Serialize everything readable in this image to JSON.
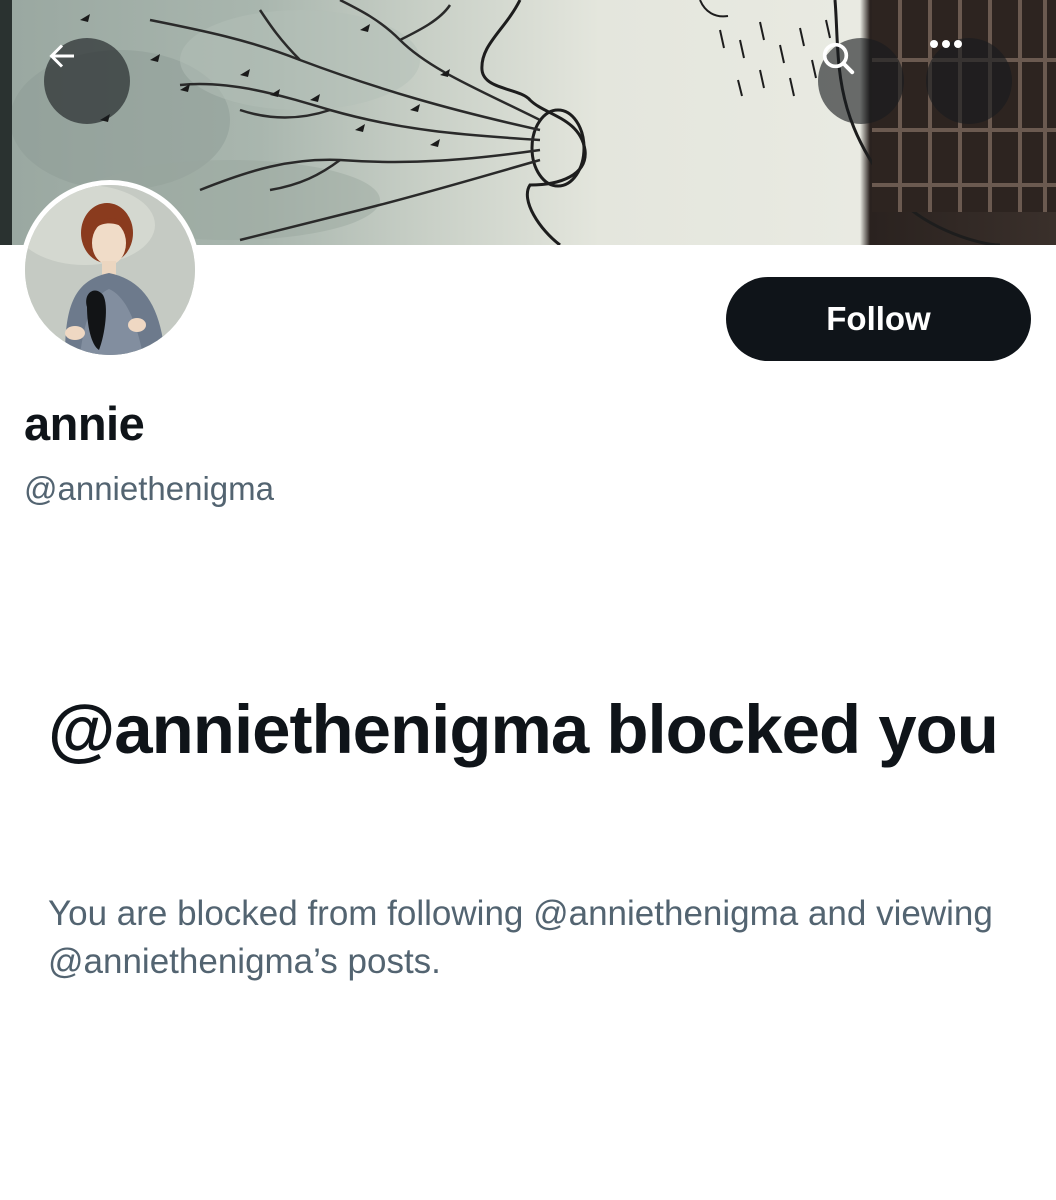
{
  "header": {
    "back_icon": "arrow-left-icon",
    "search_icon": "search-icon",
    "more_icon": "more-horizontal-icon"
  },
  "profile": {
    "display_name": "annie",
    "handle": "@anniethenigma",
    "follow_label": "Follow"
  },
  "blocked": {
    "title": "@anniethenigma blocked you",
    "description": "You are blocked from following @anniethenigma and viewing @anniethenigma’s posts."
  },
  "colors": {
    "primary_text": "#0f1419",
    "secondary_text": "#536471",
    "button_bg": "#0f1419",
    "button_text": "#ffffff"
  }
}
